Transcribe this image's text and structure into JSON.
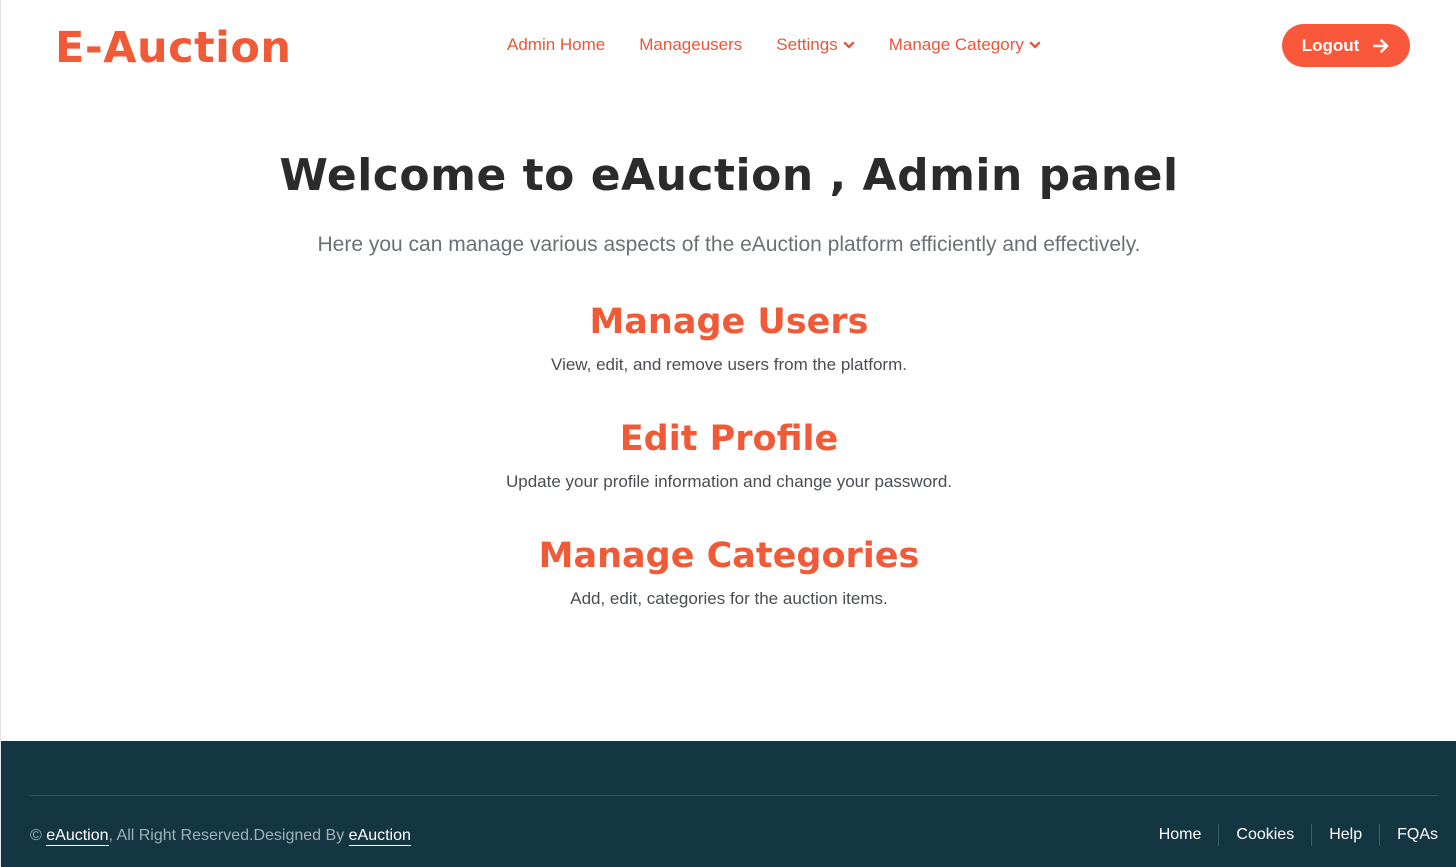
{
  "brand": {
    "logo": "E-Auction",
    "accent": "#f05a36"
  },
  "nav": {
    "items": [
      {
        "label": "Admin Home",
        "dropdown": false
      },
      {
        "label": "Manageusers",
        "dropdown": false
      },
      {
        "label": "Settings",
        "dropdown": true
      },
      {
        "label": "Manage Category",
        "dropdown": true
      }
    ],
    "logout_label": "Logout",
    "logout_icon": "arrow-right-icon"
  },
  "main": {
    "title": "Welcome to eAuction , Admin panel",
    "lead": "Here you can manage various aspects of the eAuction platform efficiently and effectively.",
    "sections": [
      {
        "title": "Manage Users",
        "desc": "View, edit, and remove users from the platform."
      },
      {
        "title": "Edit Profile",
        "desc": "Update your profile information and change your password."
      },
      {
        "title": "Manage Categories",
        "desc": "Add, edit, categories for the auction items."
      }
    ]
  },
  "footer": {
    "copyright_symbol": "©",
    "brand_link": "eAuction",
    "rights_text": ", All Right Reserved.Designed By",
    "designer_link": "eAuction",
    "links": [
      "Home",
      "Cookies",
      "Help",
      "FQAs"
    ],
    "background": "#143642"
  }
}
